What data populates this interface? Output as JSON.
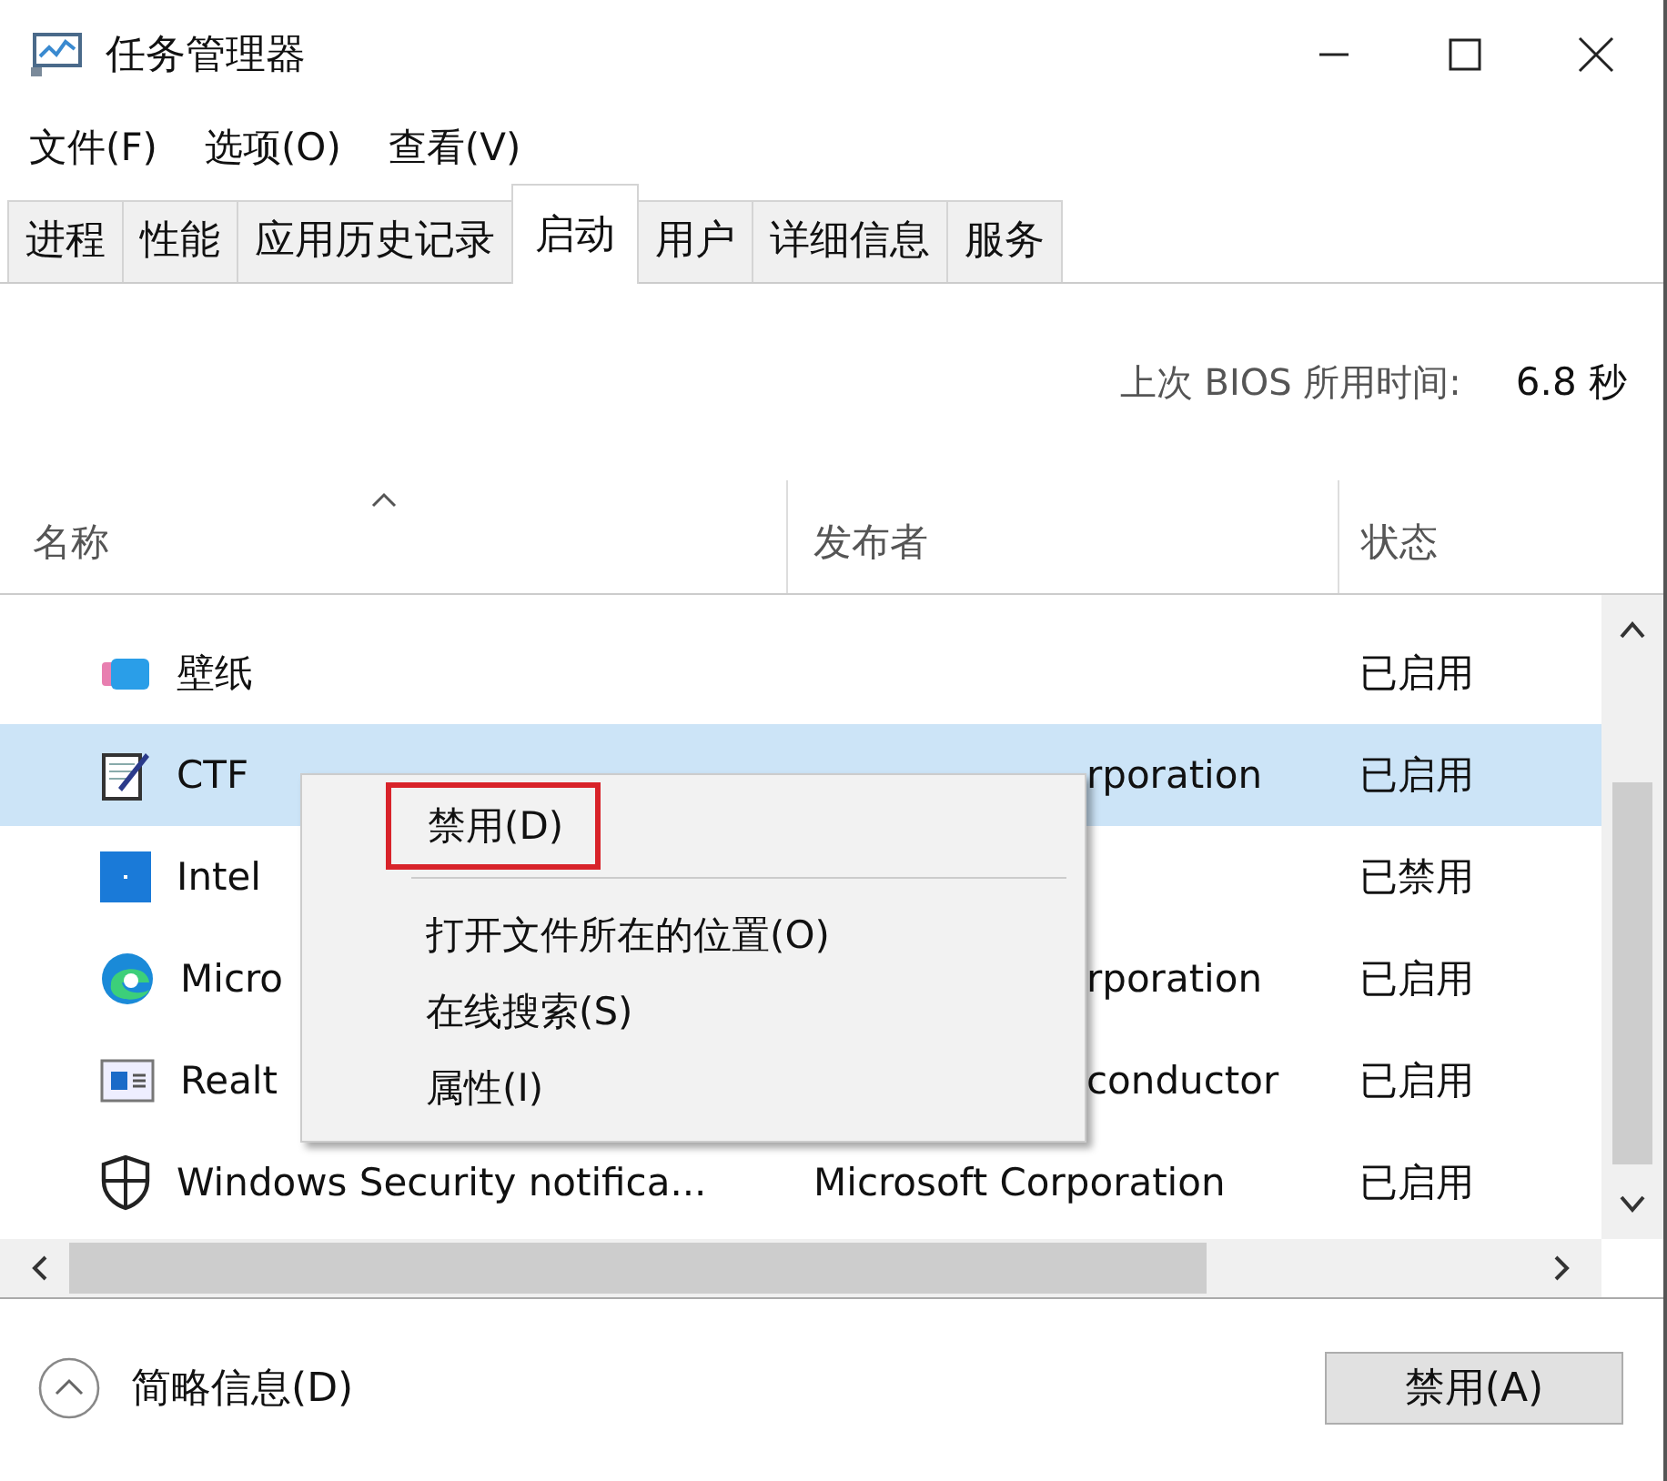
{
  "window": {
    "title": "任务管理器"
  },
  "menu": [
    "文件(F)",
    "选项(O)",
    "查看(V)"
  ],
  "tabs": [
    {
      "label": "进程",
      "selected": false
    },
    {
      "label": "性能",
      "selected": false
    },
    {
      "label": "应用历史记录",
      "selected": false
    },
    {
      "label": "启动",
      "selected": true
    },
    {
      "label": "用户",
      "selected": false
    },
    {
      "label": "详细信息",
      "selected": false
    },
    {
      "label": "服务",
      "selected": false
    }
  ],
  "bios": {
    "label": "上次 BIOS 所用时间:",
    "value": "6.8 秒"
  },
  "table": {
    "columns": [
      "名称",
      "发布者",
      "状态"
    ],
    "rows": [
      {
        "name": "壁纸",
        "status": "已启用",
        "selected": false
      },
      {
        "name": "CTF",
        "publisher": "rporation",
        "status": "已启用",
        "selected": true,
        "covered": true
      },
      {
        "name": "Intel",
        "status": "已禁用",
        "selected": false
      },
      {
        "name": "Micro",
        "publisher": "rporation",
        "status": "已启用",
        "selected": false,
        "covered": true
      },
      {
        "name": "Realt",
        "publisher": "conductor",
        "status": "已启用",
        "selected": false,
        "covered": true
      },
      {
        "name": "Windows Security notifica...",
        "publisher": "Microsoft Corporation",
        "status": "已启用",
        "selected": false,
        "covered": false
      }
    ]
  },
  "context_menu": [
    {
      "label": "禁用(D)",
      "highlighted": true
    },
    {
      "label": "打开文件所在的位置(O)",
      "highlighted": false
    },
    {
      "label": "在线搜索(S)",
      "highlighted": false
    },
    {
      "label": "属性(I)",
      "highlighted": false
    }
  ],
  "footer": {
    "details": "简略信息(D)",
    "button": "禁用(A)"
  }
}
